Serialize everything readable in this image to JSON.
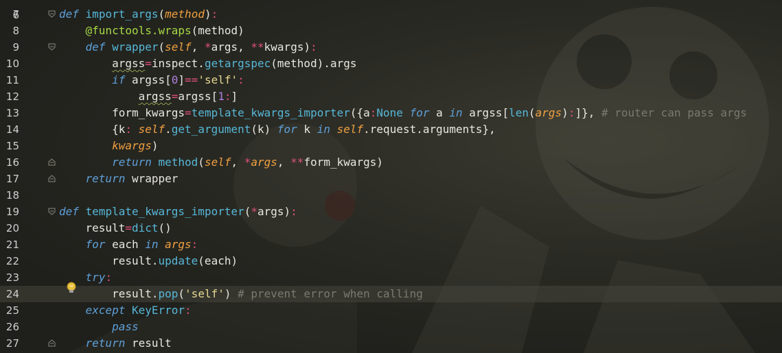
{
  "editor": {
    "top_partial_line_number": "6",
    "current_line": 24,
    "lines": [
      {
        "num": "7",
        "segments": [
          [
            "kw",
            "def"
          ],
          [
            "plain",
            " "
          ],
          [
            "fn",
            "import_args"
          ],
          [
            "plain",
            "("
          ],
          [
            "param",
            "method"
          ],
          [
            "plain",
            ")"
          ],
          [
            "op",
            ":"
          ]
        ]
      },
      {
        "num": "8",
        "segments": [
          [
            "plain",
            "    "
          ],
          [
            "deco",
            "@functools.wraps"
          ],
          [
            "plain",
            "(method)"
          ]
        ]
      },
      {
        "num": "9",
        "segments": [
          [
            "plain",
            "    "
          ],
          [
            "kw",
            "def"
          ],
          [
            "plain",
            " "
          ],
          [
            "fn",
            "wrapper"
          ],
          [
            "plain",
            "("
          ],
          [
            "self",
            "self"
          ],
          [
            "plain",
            ", "
          ],
          [
            "op",
            "*"
          ],
          [
            "plain",
            "args, "
          ],
          [
            "op",
            "**"
          ],
          [
            "plain",
            "kwargs)"
          ],
          [
            "op",
            ":"
          ]
        ]
      },
      {
        "num": "10",
        "segments": [
          [
            "plain",
            "        "
          ],
          [
            "squig",
            "argss"
          ],
          [
            "op",
            "="
          ],
          [
            "plain",
            "inspect."
          ],
          [
            "fn",
            "getargspec"
          ],
          [
            "plain",
            "(method).args"
          ]
        ]
      },
      {
        "num": "11",
        "segments": [
          [
            "plain",
            "        "
          ],
          [
            "kw",
            "if"
          ],
          [
            "plain",
            " argss["
          ],
          [
            "num",
            "0"
          ],
          [
            "plain",
            "]"
          ],
          [
            "op",
            "=="
          ],
          [
            "str",
            "'self'"
          ],
          [
            "op",
            ":"
          ]
        ]
      },
      {
        "num": "12",
        "segments": [
          [
            "plain",
            "            "
          ],
          [
            "squig",
            "argss"
          ],
          [
            "op",
            "="
          ],
          [
            "plain",
            "argss["
          ],
          [
            "num",
            "1"
          ],
          [
            "op",
            ":"
          ],
          [
            "plain",
            "]"
          ]
        ]
      },
      {
        "num": "13",
        "segments": [
          [
            "plain",
            "        form_kwargs"
          ],
          [
            "op",
            "="
          ],
          [
            "fn",
            "template_kwargs_importer"
          ],
          [
            "plain",
            "({a"
          ],
          [
            "op",
            ":"
          ],
          [
            "fn",
            "None"
          ],
          [
            "plain",
            " "
          ],
          [
            "kw",
            "for"
          ],
          [
            "plain",
            " a "
          ],
          [
            "kw",
            "in"
          ],
          [
            "plain",
            " argss["
          ],
          [
            "fn",
            "len"
          ],
          [
            "plain",
            "("
          ],
          [
            "param",
            "args"
          ],
          [
            "plain",
            ")"
          ],
          [
            "op",
            ":"
          ],
          [
            "plain",
            "]}, "
          ],
          [
            "cmt",
            "# router can pass args"
          ]
        ]
      },
      {
        "num": "14",
        "segments": [
          [
            "plain",
            "        {k"
          ],
          [
            "op",
            ":"
          ],
          [
            "plain",
            " "
          ],
          [
            "self",
            "self"
          ],
          [
            "plain",
            "."
          ],
          [
            "fn",
            "get_argument"
          ],
          [
            "plain",
            "(k) "
          ],
          [
            "kw",
            "for"
          ],
          [
            "plain",
            " k "
          ],
          [
            "kw",
            "in"
          ],
          [
            "plain",
            " "
          ],
          [
            "self",
            "self"
          ],
          [
            "plain",
            ".request.arguments},"
          ]
        ]
      },
      {
        "num": "15",
        "segments": [
          [
            "plain",
            "        "
          ],
          [
            "param",
            "kwargs"
          ],
          [
            "plain",
            ")"
          ]
        ]
      },
      {
        "num": "16",
        "segments": [
          [
            "plain",
            "        "
          ],
          [
            "kw",
            "return"
          ],
          [
            "plain",
            " "
          ],
          [
            "fn",
            "method"
          ],
          [
            "plain",
            "("
          ],
          [
            "self",
            "self"
          ],
          [
            "plain",
            ", "
          ],
          [
            "op",
            "*"
          ],
          [
            "param",
            "args"
          ],
          [
            "plain",
            ", "
          ],
          [
            "op",
            "**"
          ],
          [
            "plain",
            "form_kwargs)"
          ]
        ]
      },
      {
        "num": "17",
        "segments": [
          [
            "plain",
            "    "
          ],
          [
            "kw",
            "return"
          ],
          [
            "plain",
            " wrapper"
          ]
        ]
      },
      {
        "num": "18",
        "segments": []
      },
      {
        "num": "19",
        "segments": [
          [
            "kw",
            "def"
          ],
          [
            "plain",
            " "
          ],
          [
            "fn",
            "template_kwargs_importer"
          ],
          [
            "plain",
            "("
          ],
          [
            "op",
            "*"
          ],
          [
            "plain",
            "args)"
          ],
          [
            "op",
            ":"
          ]
        ]
      },
      {
        "num": "20",
        "segments": [
          [
            "plain",
            "    result"
          ],
          [
            "op",
            "="
          ],
          [
            "fn",
            "dict"
          ],
          [
            "plain",
            "()"
          ]
        ]
      },
      {
        "num": "21",
        "segments": [
          [
            "plain",
            "    "
          ],
          [
            "kw",
            "for"
          ],
          [
            "plain",
            " each "
          ],
          [
            "kw",
            "in"
          ],
          [
            "plain",
            " "
          ],
          [
            "param",
            "args"
          ],
          [
            "op",
            ":"
          ]
        ]
      },
      {
        "num": "22",
        "segments": [
          [
            "plain",
            "        result."
          ],
          [
            "fn",
            "update"
          ],
          [
            "plain",
            "(each)"
          ]
        ]
      },
      {
        "num": "23",
        "segments": [
          [
            "plain",
            "    "
          ],
          [
            "kw",
            "try"
          ],
          [
            "op",
            ":"
          ]
        ]
      },
      {
        "num": "24",
        "segments": [
          [
            "plain",
            "        result."
          ],
          [
            "fn",
            "pop"
          ],
          [
            "plain",
            "("
          ],
          [
            "str",
            "'self'"
          ],
          [
            "plain",
            ") "
          ],
          [
            "cmt",
            "# prevent error when calling"
          ]
        ]
      },
      {
        "num": "25",
        "segments": [
          [
            "plain",
            "    "
          ],
          [
            "kw",
            "except"
          ],
          [
            "plain",
            " "
          ],
          [
            "fn",
            "KeyError"
          ],
          [
            "op",
            ":"
          ]
        ]
      },
      {
        "num": "26",
        "segments": [
          [
            "plain",
            "        "
          ],
          [
            "kw",
            "pass"
          ]
        ]
      },
      {
        "num": "27",
        "segments": [
          [
            "plain",
            "    "
          ],
          [
            "kw",
            "return"
          ],
          [
            "plain",
            " result"
          ]
        ]
      }
    ],
    "fold_markers": {
      "7": "open",
      "9": "open",
      "16": "close",
      "17": "close",
      "19": "open",
      "27": "close"
    }
  },
  "icons": {
    "fold_open": "fold-open-icon",
    "fold_close": "fold-close-icon",
    "intention": "lightbulb-icon"
  },
  "colors": {
    "background": "#2a2a24",
    "keyword": "#5ea0d8",
    "function": "#56b8d8",
    "parameter": "#f0a040",
    "operator": "#e0507a",
    "string": "#e6d890",
    "number": "#b080e0",
    "comment": "#7a7a70",
    "decorator": "#a6d845",
    "current_line": "#3a3a32"
  }
}
